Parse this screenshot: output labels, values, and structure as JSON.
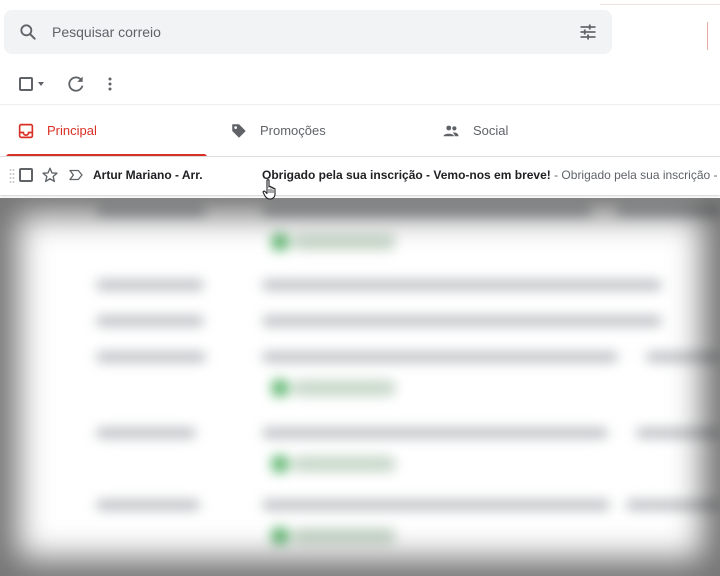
{
  "search": {
    "placeholder": "Pesquisar correio"
  },
  "tabs": [
    {
      "label": "Principal",
      "active": true
    },
    {
      "label": "Promoções",
      "active": false
    },
    {
      "label": "Social",
      "active": false
    }
  ],
  "emails": [
    {
      "sender": "Artur Mariano - Arr.",
      "subject": "Obrigado pela sua inscrição - Vemo-nos em breve!",
      "snippet": " - Obrigado pela sua inscrição - Vemo-nos em breve!"
    }
  ],
  "colors": {
    "accent": "#d93025",
    "icon": "#5f6368",
    "search_bg": "#f1f3f4"
  },
  "icons": [
    "search-icon",
    "filter-icon",
    "refresh-icon",
    "more-vert-icon",
    "inbox-icon",
    "tag-icon",
    "people-icon",
    "star-icon",
    "important-icon",
    "hand-cursor-icon"
  ]
}
